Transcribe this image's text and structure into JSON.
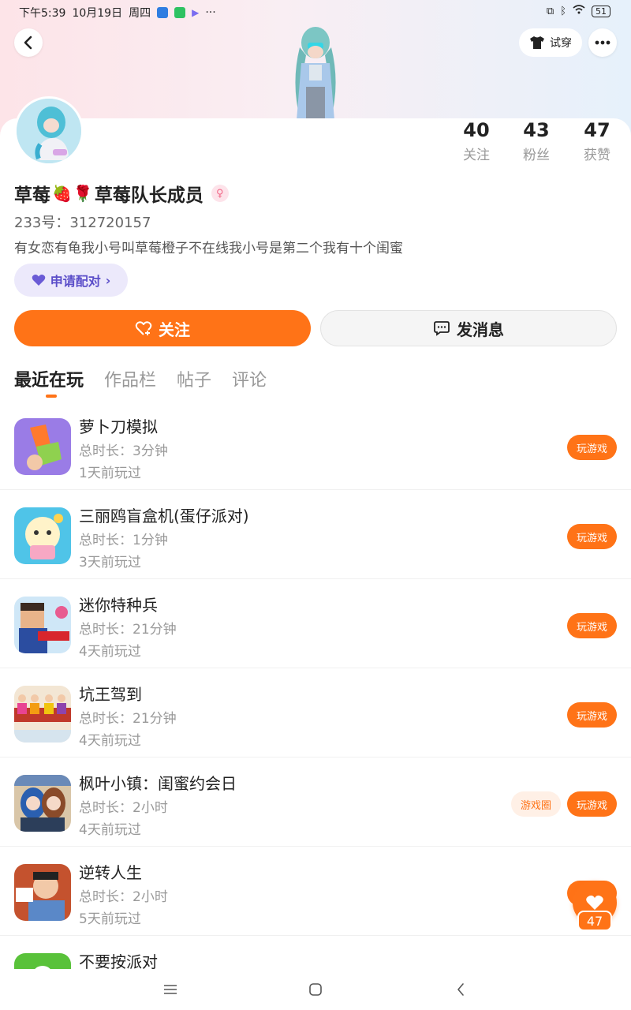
{
  "status_bar": {
    "time": "下午5:39",
    "date": "10月19日",
    "weekday": "周四",
    "more": "···",
    "battery": "51"
  },
  "header": {
    "try_on_label": "试穿"
  },
  "profile": {
    "name": "草莓",
    "name_emoji_1": "🍓",
    "name_emoji_2": "🌹",
    "name_suffix": "草莓队长成员",
    "gender_symbol": "♀",
    "uid_label": "233号：",
    "uid_value": "312720157",
    "bio": "有女恋有龟我小号叫草莓橙子不在线我小号是第二个我有十个闺蜜",
    "pair_label": "申请配对",
    "pair_arrow": "›",
    "stats": [
      {
        "value": "40",
        "label": "关注"
      },
      {
        "value": "43",
        "label": "粉丝"
      },
      {
        "value": "47",
        "label": "获赞"
      }
    ]
  },
  "actions": {
    "follow_label": "关注",
    "message_label": "发消息"
  },
  "tabs": [
    {
      "label": "最近在玩"
    },
    {
      "label": "作品栏"
    },
    {
      "label": "帖子"
    },
    {
      "label": "评论"
    }
  ],
  "games": [
    {
      "name": "萝卜刀模拟",
      "duration": "总时长：3分钟",
      "last_played": "1天前玩过",
      "play_label": "玩游戏"
    },
    {
      "name": "三丽鸥盲盒机(蛋仔派对)",
      "duration": "总时长：1分钟",
      "last_played": "3天前玩过",
      "play_label": "玩游戏"
    },
    {
      "name": "迷你特种兵",
      "duration": "总时长：21分钟",
      "last_played": "4天前玩过",
      "play_label": "玩游戏"
    },
    {
      "name": "坑王驾到",
      "duration": "总时长：21分钟",
      "last_played": "4天前玩过",
      "play_label": "玩游戏"
    },
    {
      "name": "枫叶小镇：闺蜜约会日",
      "duration": "总时长：2小时",
      "last_played": "4天前玩过",
      "play_label": "玩游戏",
      "circle_label": "游戏圈"
    },
    {
      "name": "逆转人生",
      "duration": "总时长：2小时",
      "last_played": "5天前玩过",
      "play_label": "玩游戏"
    },
    {
      "name": "不要按派对"
    }
  ],
  "floating_like": {
    "count": "47"
  },
  "colors": {
    "accent": "#ff7317",
    "pair_bg": "#ece9fb",
    "pair_text": "#5b4ec9"
  }
}
